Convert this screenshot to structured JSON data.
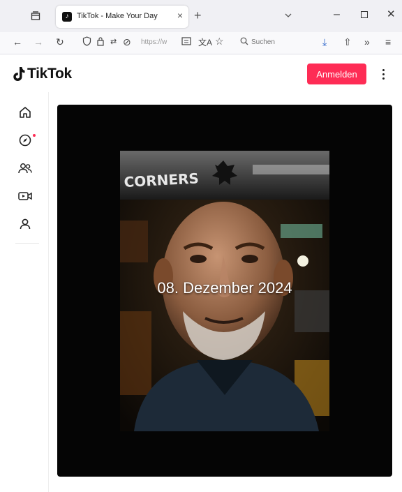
{
  "browser": {
    "tab_title": "TikTok - Make Your Day",
    "tab_close": "×",
    "new_tab": "+",
    "url": "https://w",
    "search_placeholder": "Suchen"
  },
  "header": {
    "logo_text": "TikTok",
    "login_label": "Anmelden"
  },
  "sidebar": {
    "items": [
      {
        "icon": "home-icon"
      },
      {
        "icon": "explore-icon"
      },
      {
        "icon": "following-icon"
      },
      {
        "icon": "live-icon"
      },
      {
        "icon": "profile-icon"
      }
    ]
  },
  "video": {
    "overlay_text": "08. Dezember 2024",
    "sign_text": "CORNERS"
  },
  "colors": {
    "accent": "#fe2c55",
    "chrome_bg": "#f0f0f4"
  }
}
